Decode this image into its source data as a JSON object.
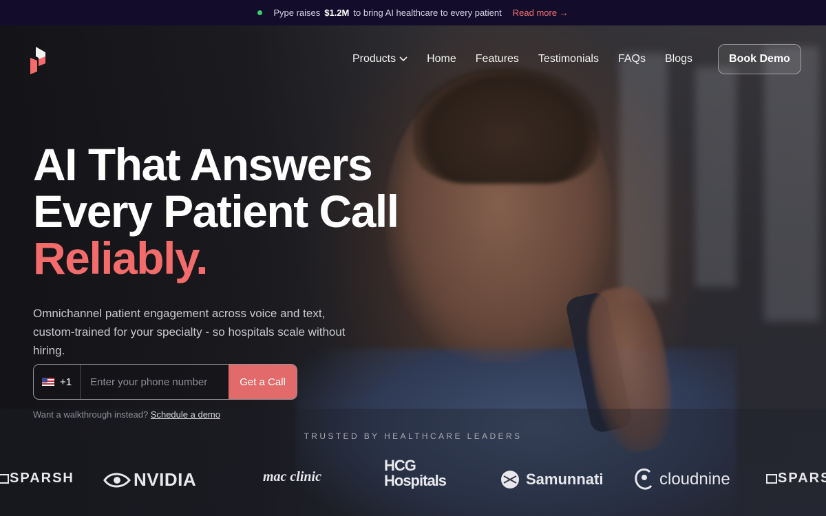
{
  "announcement": {
    "prefix": "Pype raises",
    "amount": "$1.2M",
    "suffix": "to bring AI healthcare to every patient",
    "link_label": "Read more →"
  },
  "nav": {
    "items": [
      "Products",
      "Home",
      "Features",
      "Testimonials",
      "FAQs",
      "Blogs"
    ],
    "cta_label": "Book Demo"
  },
  "hero": {
    "headline_line1": "AI That Answers",
    "headline_line2": "Every Patient Call",
    "headline_accent": "Reliably.",
    "subtext": "Omnichannel patient engagement across voice and text, custom-trained for your specialty - so hospitals scale without hiring.",
    "phone_form": {
      "country_code": "+1",
      "placeholder": "Enter your phone number",
      "submit_label": "Get a Call"
    },
    "walkthrough_text": "Want a walkthrough instead?",
    "walkthrough_link": "Schedule a demo"
  },
  "trusted": {
    "label": "TRUSTED BY HEALTHCARE LEADERS",
    "logos": [
      "SPARSH",
      "NVIDIA",
      "mac clinic",
      "HCG Hospitals",
      "Samunnati",
      "cloudnine",
      "SPARSH"
    ]
  },
  "colors": {
    "accent": "#f36b6b",
    "announcement_bg": "#130d2b",
    "cta_button": "#e36a6a"
  }
}
